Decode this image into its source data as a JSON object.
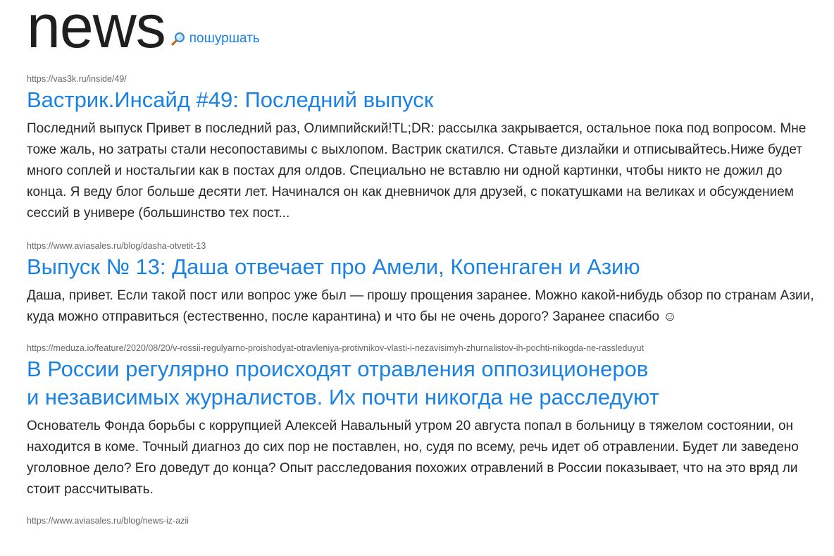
{
  "header": {
    "logo": "news",
    "search_icon": "magnifier-icon",
    "search_label": "пошуршать"
  },
  "items": [
    {
      "url": "https://vas3k.ru/inside/49/",
      "title": "Вастрик.Инсайд #49: Последний выпуск",
      "snippet": "Последний выпуск Привет в последний раз, Олимпийский!TL;DR: рассылка закрывается, остальное пока под вопросом. Мне тоже жаль, но затраты стали несопоставимы с выхлопом. Вастрик скатился. Ставьте дизлайки и отписывайтесь.Ниже будет много соплей и ностальгии как в постах для олдов. Специально не вставлю ни одной картинки, чтобы никто не дожил до конца. Я веду блог больше десяти лет. Начинался он как дневничок для друзей, с покатушками на великах и обсуждением сессий в универе (большинство тех пост..."
    },
    {
      "url": "https://www.aviasales.ru/blog/dasha-otvetit-13",
      "title": "Выпуск № 13: Даша отвечает про Амели, Копенгаген и Азию",
      "snippet": "Даша, привет. Если такой пост или вопрос уже был — прошу прощения заранее. Можно какой-нибудь обзор по странам Азии, куда можно отправиться (естественно, после карантина) и что бы не очень дорого? Заранее спасибо ☺"
    },
    {
      "url": "https://meduza.io/feature/2020/08/20/v-rossii-regulyarno-proishodyat-otravleniya-protivnikov-vlasti-i-nezavisimyh-zhurnalistov-ih-pochti-nikogda-ne-rassleduyut",
      "title_line1": "В России регулярно происходят отравления оппозиционеров",
      "title_line2": "и независимых журналистов. Их почти никогда не расследуют",
      "snippet": "Основатель Фонда борьбы с коррупцией Алексей Навальный утром 20 августа попал в больницу в тяжелом состоянии, он находится в коме. Точный диагноз до сих пор не поставлен, но, судя по всему, речь идет об отравлении. Будет ли заведено уголовное дело? Его доведут до конца? Опыт расследования похожих отравлений в России показывает, что на это вряд ли стоит рассчитывать."
    },
    {
      "url": "https://www.aviasales.ru/blog/news-iz-azii"
    }
  ],
  "colors": {
    "link": "#1a82e2",
    "text": "#262626",
    "url": "#666666",
    "logo": "#1f1f1f"
  }
}
